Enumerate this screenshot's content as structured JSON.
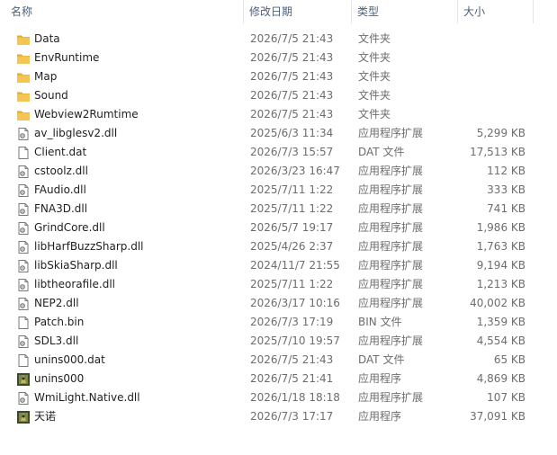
{
  "columns": {
    "name": "名称",
    "date": "修改日期",
    "type": "类型",
    "size": "大小"
  },
  "files": [
    {
      "name": "Data",
      "date": "2026/7/5 21:43",
      "type": "文件夹",
      "size": "",
      "icon": "folder-icon"
    },
    {
      "name": "EnvRuntime",
      "date": "2026/7/5 21:43",
      "type": "文件夹",
      "size": "",
      "icon": "folder-icon"
    },
    {
      "name": "Map",
      "date": "2026/7/5 21:43",
      "type": "文件夹",
      "size": "",
      "icon": "folder-icon"
    },
    {
      "name": "Sound",
      "date": "2026/7/5 21:43",
      "type": "文件夹",
      "size": "",
      "icon": "folder-icon"
    },
    {
      "name": "Webview2Rumtime",
      "date": "2026/7/5 21:43",
      "type": "文件夹",
      "size": "",
      "icon": "folder-icon"
    },
    {
      "name": "av_libglesv2.dll",
      "date": "2025/6/3 11:34",
      "type": "应用程序扩展",
      "size": "5,299 KB",
      "icon": "dll-file-icon"
    },
    {
      "name": "Client.dat",
      "date": "2026/7/3 15:57",
      "type": "DAT 文件",
      "size": "17,513 KB",
      "icon": "blank-file-icon"
    },
    {
      "name": "cstoolz.dll",
      "date": "2026/3/23 16:47",
      "type": "应用程序扩展",
      "size": "112 KB",
      "icon": "dll-file-icon"
    },
    {
      "name": "FAudio.dll",
      "date": "2025/7/11 1:22",
      "type": "应用程序扩展",
      "size": "333 KB",
      "icon": "dll-file-icon"
    },
    {
      "name": "FNA3D.dll",
      "date": "2025/7/11 1:22",
      "type": "应用程序扩展",
      "size": "741 KB",
      "icon": "dll-file-icon"
    },
    {
      "name": "GrindCore.dll",
      "date": "2026/5/7 19:17",
      "type": "应用程序扩展",
      "size": "1,986 KB",
      "icon": "dll-file-icon"
    },
    {
      "name": "libHarfBuzzSharp.dll",
      "date": "2025/4/26 2:37",
      "type": "应用程序扩展",
      "size": "1,763 KB",
      "icon": "dll-file-icon"
    },
    {
      "name": "libSkiaSharp.dll",
      "date": "2024/11/7 21:55",
      "type": "应用程序扩展",
      "size": "9,194 KB",
      "icon": "dll-file-icon"
    },
    {
      "name": "libtheorafile.dll",
      "date": "2025/7/11 1:22",
      "type": "应用程序扩展",
      "size": "1,213 KB",
      "icon": "dll-file-icon"
    },
    {
      "name": "NEP2.dll",
      "date": "2026/3/17 10:16",
      "type": "应用程序扩展",
      "size": "40,002 KB",
      "icon": "dll-file-icon"
    },
    {
      "name": "Patch.bin",
      "date": "2026/7/3 17:19",
      "type": "BIN 文件",
      "size": "1,359 KB",
      "icon": "blank-file-icon"
    },
    {
      "name": "SDL3.dll",
      "date": "2025/7/10 19:57",
      "type": "应用程序扩展",
      "size": "4,554 KB",
      "icon": "dll-file-icon"
    },
    {
      "name": "unins000.dat",
      "date": "2026/7/5 21:43",
      "type": "DAT 文件",
      "size": "65 KB",
      "icon": "blank-file-icon"
    },
    {
      "name": "unins000",
      "date": "2026/7/5 21:41",
      "type": "应用程序",
      "size": "4,869 KB",
      "icon": "app-icon"
    },
    {
      "name": "WmiLight.Native.dll",
      "date": "2026/1/18 18:18",
      "type": "应用程序扩展",
      "size": "107 KB",
      "icon": "dll-file-icon"
    },
    {
      "name": "天诺",
      "date": "2026/7/3 17:17",
      "type": "应用程序",
      "size": "37,091 KB",
      "icon": "app-icon"
    }
  ],
  "colors": {
    "folder": "#f4c552",
    "folder_dark": "#e3a928",
    "header_text": "#4c607a",
    "secondary_text": "#6d6d6d"
  }
}
